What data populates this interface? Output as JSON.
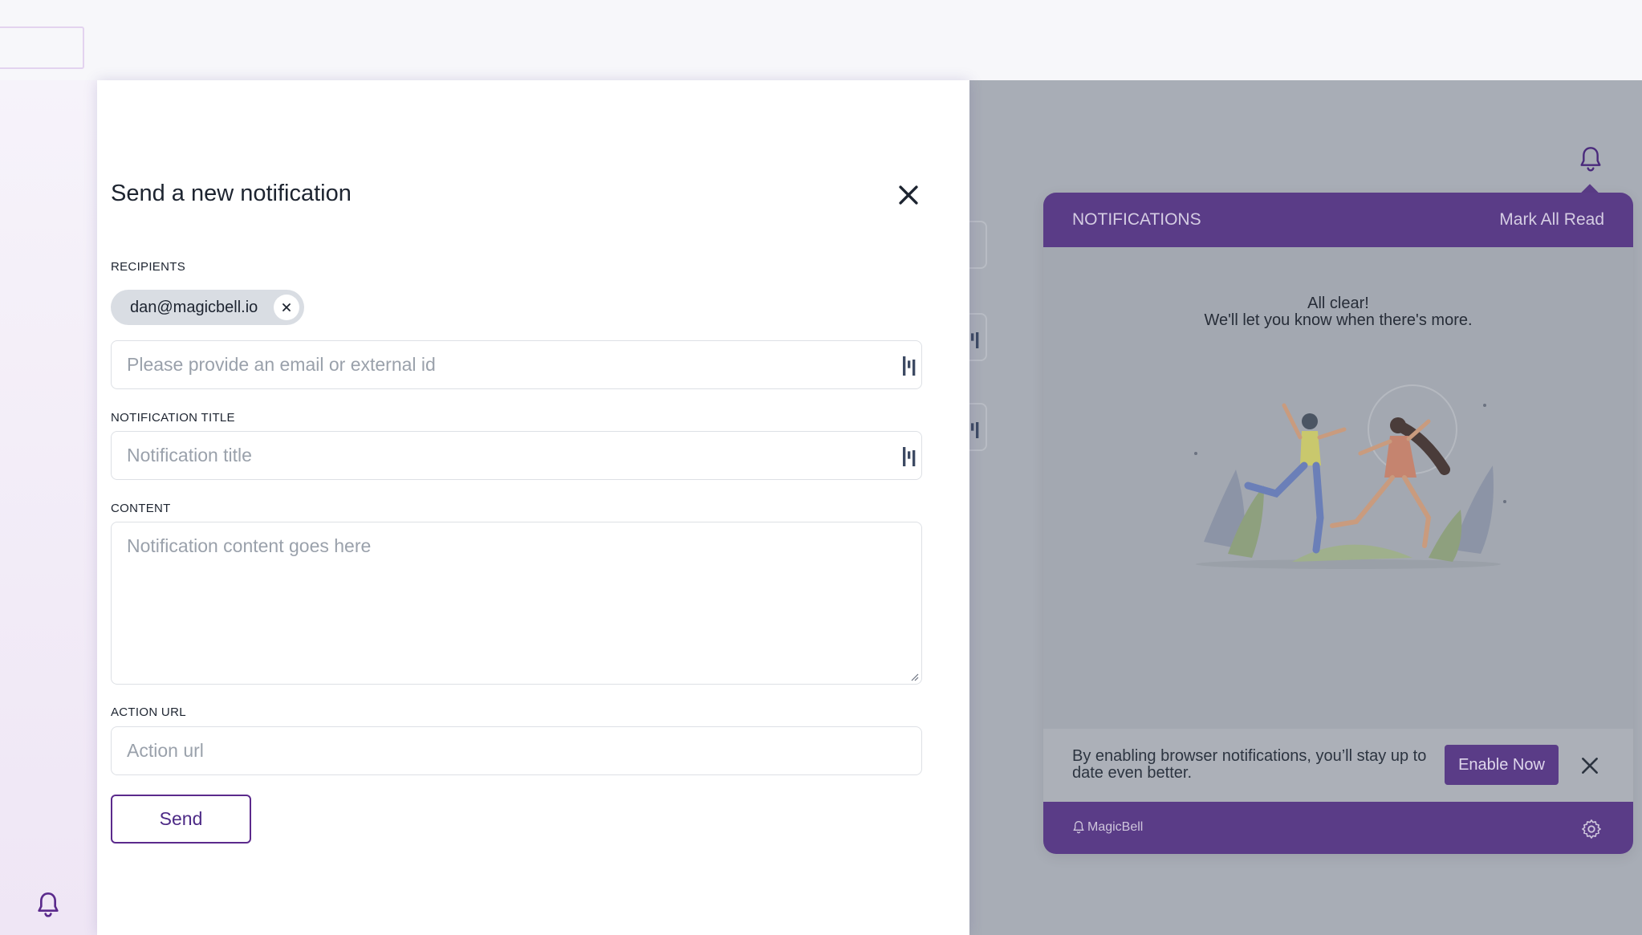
{
  "form": {
    "title": "Send a new notification",
    "recipients_label": "RECIPIENTS",
    "recipient_chip": "dan@magicbell.io",
    "recipient_placeholder": "Please provide an email or external id",
    "title_label": "NOTIFICATION TITLE",
    "title_placeholder": "Notification title",
    "content_label": "CONTENT",
    "content_placeholder": "Notification content goes here",
    "action_url_label": "ACTION URL",
    "action_url_placeholder": "Action url",
    "send_label": "Send"
  },
  "inbox": {
    "header_title": "NOTIFICATIONS",
    "mark_all_read": "Mark All Read",
    "empty_title": "All clear!",
    "empty_subtitle": "We'll let you know when there's more.",
    "push_prompt": "By enabling browser notifications, you’ll stay up to date even better.",
    "enable_now": "Enable Now",
    "brand": "MagicBell"
  },
  "colors": {
    "brand_purple": "#5a3c87",
    "send_border": "#5b2a8c",
    "overlay": "#a8adb6"
  },
  "icons": {
    "close": "close-icon",
    "chip_remove": "close-icon",
    "field_trailing": "variable-icon",
    "bell": "bell-icon",
    "settings": "gear-icon"
  }
}
